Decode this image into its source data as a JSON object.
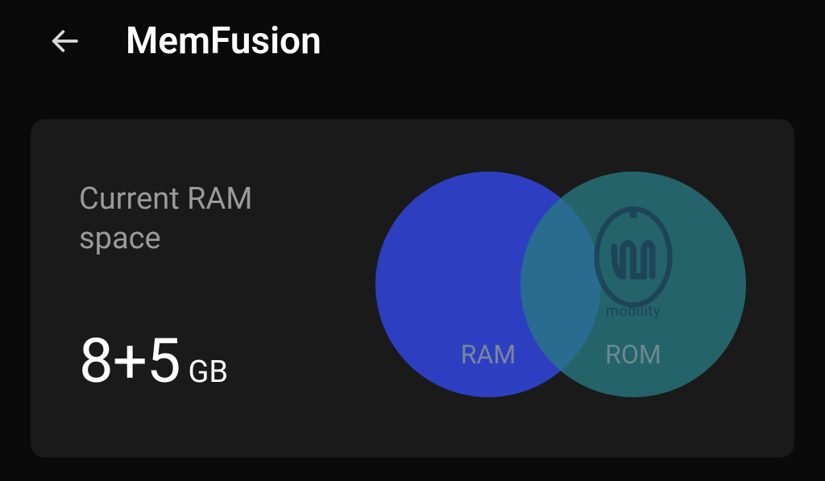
{
  "header": {
    "title": "MemFusion"
  },
  "card": {
    "label": "Current RAM space",
    "value": "8+5",
    "unit": "GB",
    "ram_label": "RAM",
    "rom_label": "ROM"
  },
  "watermark": {
    "text": "mobility"
  },
  "colors": {
    "ram_circle": "#2d3fc0",
    "rom_circle": "#2a7882"
  }
}
